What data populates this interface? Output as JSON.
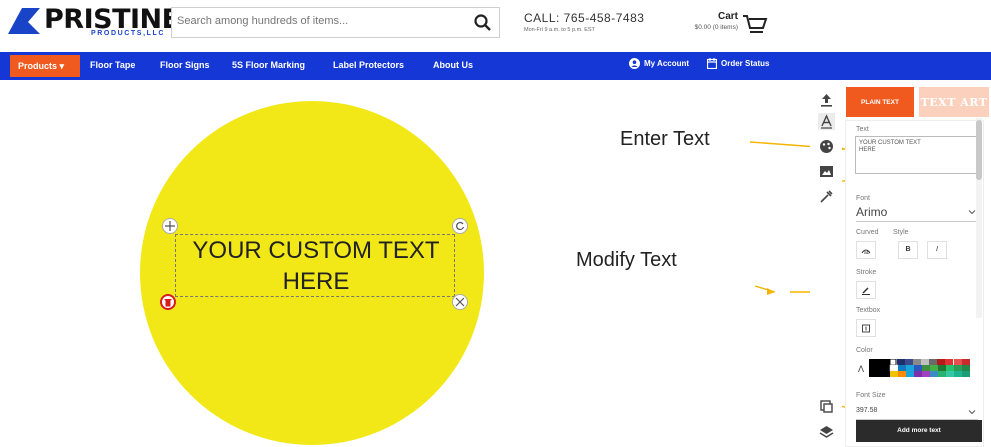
{
  "header": {
    "logo_text": "PRISTINE",
    "logo_sub": "PRODUCTS,LLC",
    "search_placeholder": "Search among hundreds of items...",
    "call_main": "CALL: 765-458-7483",
    "call_sub": "Mon-Fri 9 a.m. to 5 p.m. EST",
    "cart_title": "Cart",
    "cart_sub": "$0.00 (0 items)"
  },
  "nav": {
    "products": "Products",
    "items": [
      "Floor Tape",
      "Floor Signs",
      "5S Floor Marking",
      "Label Protectors",
      "About Us"
    ],
    "my_account": "My Account",
    "order_status": "Order Status"
  },
  "design": {
    "fill_color": "#f2e817",
    "text_line1": "YOUR CUSTOM TEXT",
    "text_line2": "HERE"
  },
  "annotations": {
    "enter_text": "Enter Text",
    "modify_text": "Modify Text"
  },
  "panel": {
    "tab_plain": "PLAIN TEXT",
    "tab_art": "TEXT ART",
    "text_label": "Text",
    "text_value": "YOUR CUSTOM TEXT\nHERE",
    "font_label": "Font",
    "font_value": "Arimo",
    "curved_label": "Curved",
    "style_label": "Style",
    "stroke_label": "Stroke",
    "textbox_label": "Textbox",
    "color_label": "Color",
    "font_size_label": "Font Size",
    "font_size_value": "397.58",
    "add_button": "Add more text",
    "accent_color": "#f05a1e"
  }
}
